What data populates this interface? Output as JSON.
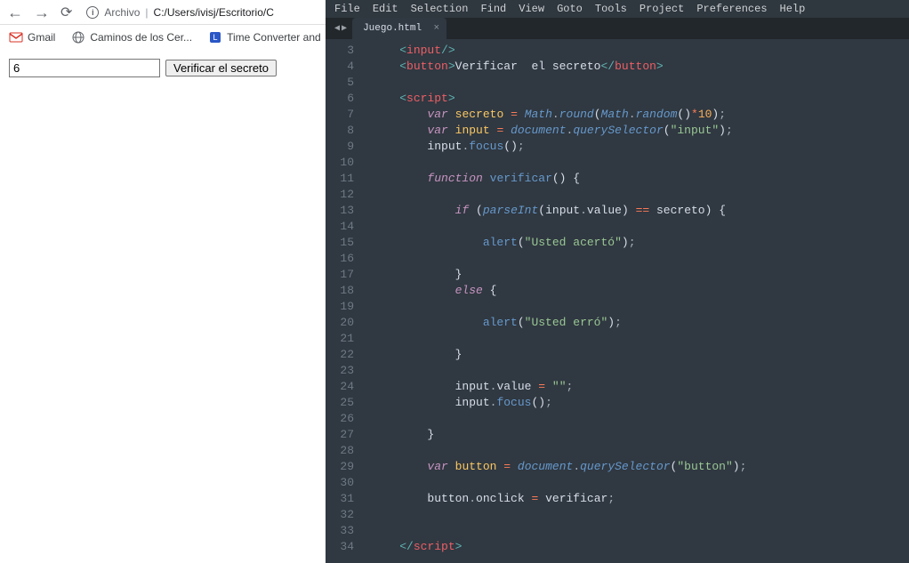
{
  "chrome": {
    "archivo_label": "Archivo",
    "url": "C:/Users/ivisj/Escritorio/C"
  },
  "bookmarks": {
    "gmail": "Gmail",
    "caminos": "Caminos de los Cer...",
    "time": "Time Converter and"
  },
  "page": {
    "input_value": "6",
    "button_label": "Verificar el secreto"
  },
  "editor": {
    "menus": [
      "File",
      "Edit",
      "Selection",
      "Find",
      "View",
      "Goto",
      "Tools",
      "Project",
      "Preferences",
      "Help"
    ],
    "tab_name": "Juego.html",
    "line_start": 3,
    "line_end": 34,
    "code_tokens": {
      "input_tag": "input",
      "button_tag": "button",
      "button_text": "Verificar  el secreto",
      "script_tag": "script",
      "var": "var",
      "function": "function",
      "if": "if",
      "else": "else",
      "secreto": "secreto",
      "input_id": "input",
      "button_id": "button",
      "verificar": "verificar",
      "Math": "Math",
      "round": "round",
      "random": "random",
      "ten": "10",
      "document": "document",
      "querySelector": "querySelector",
      "str_input": "\"input\"",
      "str_button": "\"button\"",
      "focus": "focus",
      "parseInt": "parseInt",
      "value": "value",
      "eqeq": "==",
      "alert": "alert",
      "str_acerto": "\"Usted acertó\"",
      "str_erro": "\"Usted erró\"",
      "str_empty": "\"\"",
      "onclick": "onclick"
    }
  }
}
